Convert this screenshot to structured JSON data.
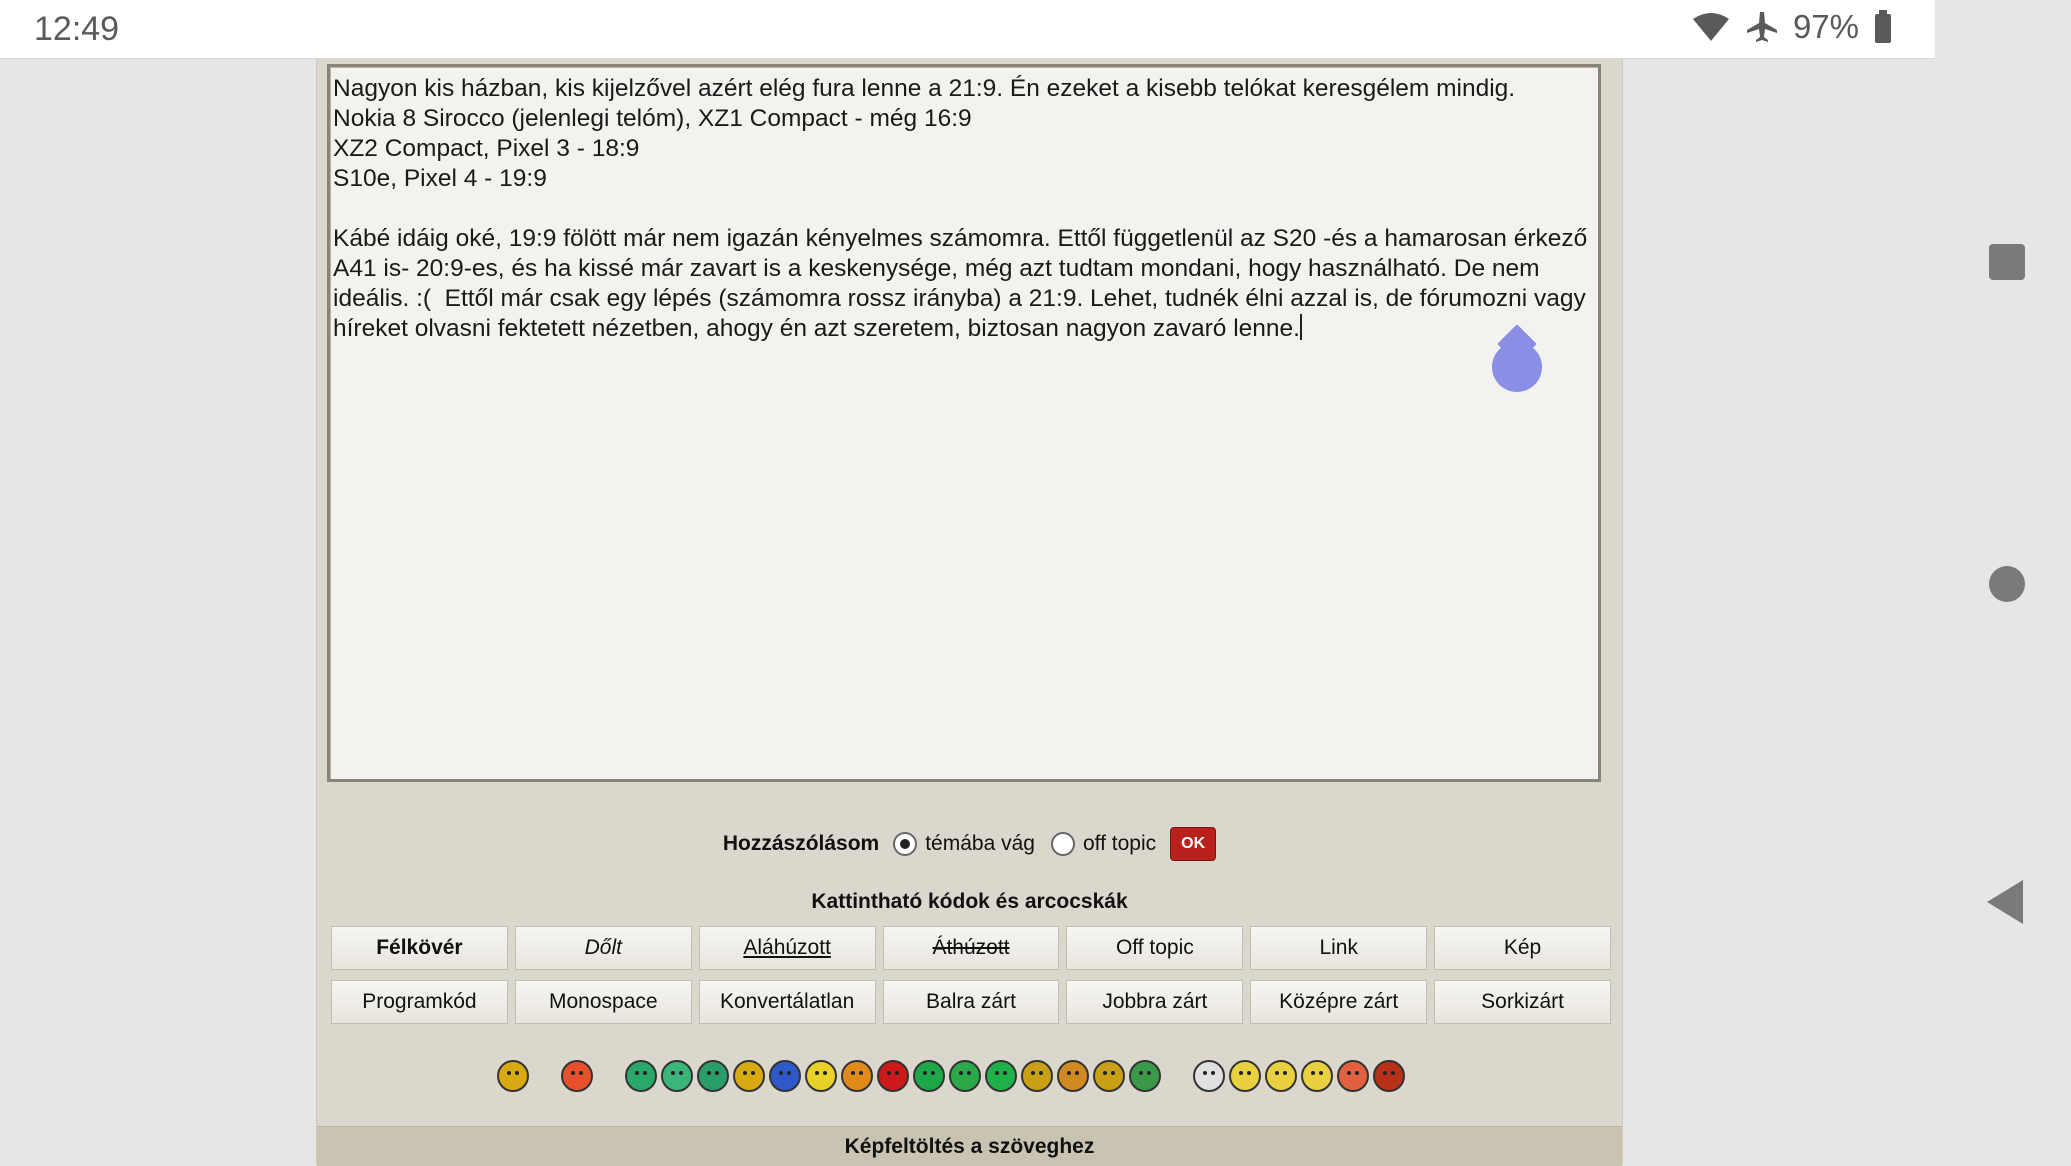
{
  "status_bar": {
    "time": "12:49",
    "battery": "97%"
  },
  "editor": {
    "text": "Nagyon kis házban, kis kijelzővel azért elég fura lenne a 21:9. Én ezeket a kisebb telókat keresgélem mindig.\nNokia 8 Sirocco (jelenlegi telóm), XZ1 Compact - még 16:9\nXZ2 Compact, Pixel 3 - 18:9\nS10e, Pixel 4 - 19:9\n\nKábé idáig oké, 19:9 fölött már nem igazán kényelmes számomra. Ettől függetlenül az S20 -és a hamarosan érkező A41 is- 20:9-es, és ha kissé már zavart is a keskenysége, még azt tudtam mondani, hogy használható. De nem ideális. :(  Ettől már csak egy lépés (számomra rossz irányba) a 21:9. Lehet, tudnék élni azzal is, de fórumozni vagy híreket olvasni fektetett nézetben, ahogy én azt szeretem, biztosan nagyon zavaró lenne."
  },
  "post_type": {
    "label": "Hozzászólásom",
    "option_on_topic": "témába vág",
    "option_off_topic": "off topic",
    "selected": "témába vág",
    "ok_label": "OK"
  },
  "codes": {
    "title": "Kattintható kódok és arcocskák",
    "row1": [
      "Félkövér",
      "Dőlt",
      "Aláhúzott",
      "Áthúzott",
      "Off topic",
      "Link",
      "Kép"
    ],
    "row2": [
      "Programkód",
      "Monospace",
      "Konvertálatlan",
      "Balra zárt",
      "Jobbra zárt",
      "Középre zárt",
      "Sorkizárt"
    ]
  },
  "smiley_colors": [
    "#d9a912",
    "#e8502c",
    "#2aa86a",
    "#3bb57a",
    "#2a9d6a",
    "#d9a912",
    "#2f58c8",
    "#e8d22a",
    "#e08a1a",
    "#cc1a1a",
    "#1fa84a",
    "#2aa84a",
    "#1fb04a",
    "#c9a015",
    "#d08a20",
    "#c9a015",
    "#3a9a4a",
    "#e0e0e0",
    "#e8d040",
    "#e8d040",
    "#e8d040",
    "#e06040",
    "#b83018"
  ],
  "bottom_bar": {
    "label": "Képfeltöltés a szöveghez"
  },
  "colors": {
    "panel_bg": "#dbd7cd",
    "editor_bg": "#f3f2ee",
    "ok_red": "#b8211c",
    "handle": "#8a8fe6"
  }
}
